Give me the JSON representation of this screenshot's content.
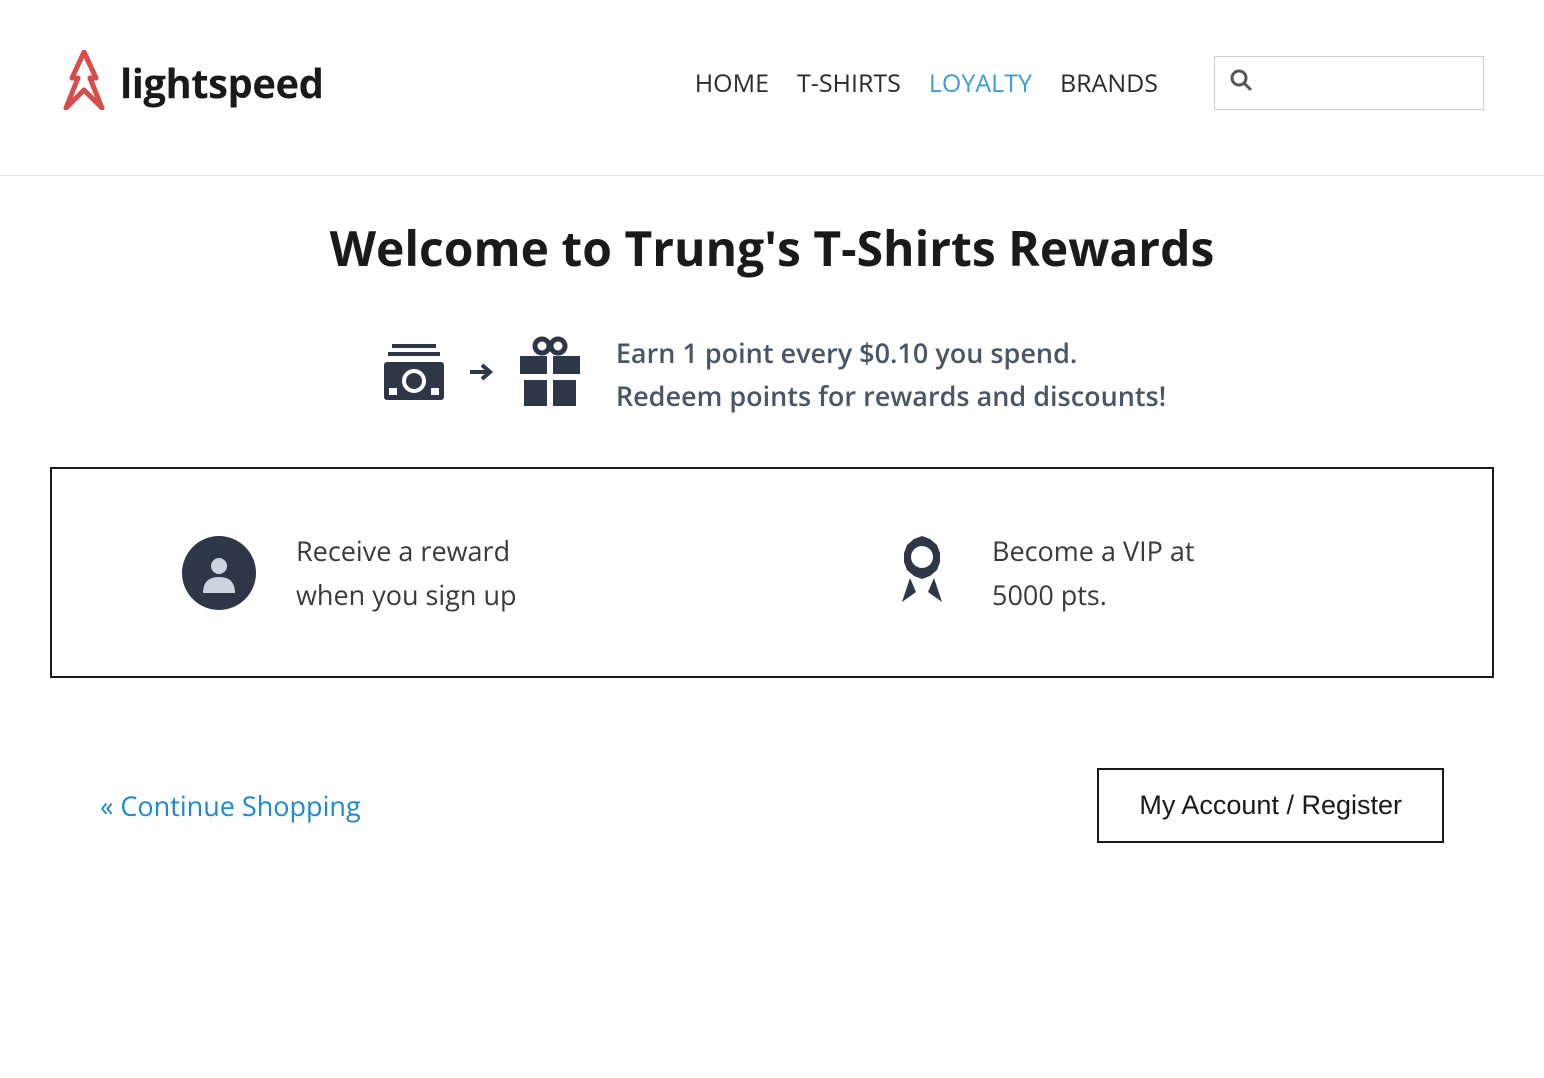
{
  "header": {
    "logo_text": "lightspeed",
    "nav": {
      "home": "HOME",
      "tshirts": "T-SHIRTS",
      "loyalty": "LOYALTY",
      "brands": "BRANDS"
    },
    "search_placeholder": ""
  },
  "main": {
    "title": "Welcome to Trung's T-Shirts Rewards",
    "earn_line1": "Earn 1 point every $0.10 you spend.",
    "earn_line2": "Redeem points for rewards and discounts!",
    "signup_reward_line1": "Receive a reward",
    "signup_reward_line2": "when you sign up",
    "vip_line1": "Become a VIP at",
    "vip_line2": "5000 pts."
  },
  "footer": {
    "continue_shopping": "« Continue Shopping",
    "account_button": "My Account / Register"
  }
}
